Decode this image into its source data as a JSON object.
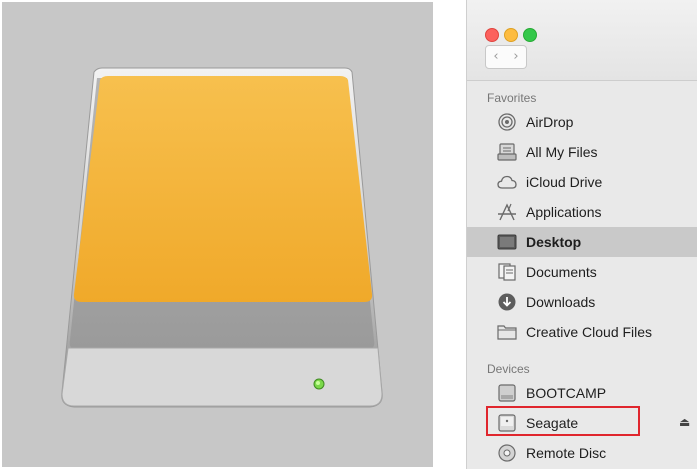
{
  "finder": {
    "sections": {
      "favorites": "Favorites",
      "devices": "Devices"
    },
    "favorites": [
      {
        "label": "AirDrop",
        "icon": "airdrop-icon"
      },
      {
        "label": "All My Files",
        "icon": "all-my-files-icon"
      },
      {
        "label": "iCloud Drive",
        "icon": "icloud-drive-icon"
      },
      {
        "label": "Applications",
        "icon": "applications-icon"
      },
      {
        "label": "Desktop",
        "icon": "desktop-icon",
        "selected": true
      },
      {
        "label": "Documents",
        "icon": "documents-icon"
      },
      {
        "label": "Downloads",
        "icon": "downloads-icon"
      },
      {
        "label": "Creative Cloud Files",
        "icon": "folder-icon"
      }
    ],
    "devices": [
      {
        "label": "BOOTCAMP",
        "icon": "disk-icon"
      },
      {
        "label": "Seagate",
        "icon": "external-disk-icon",
        "eject": "⏏",
        "highlighted": true
      },
      {
        "label": "Remote Disc",
        "icon": "optical-disc-icon"
      }
    ],
    "nav": {
      "back": "‹",
      "forward": "›"
    }
  },
  "colors": {
    "drive_top": "#f4b33c",
    "highlight": "#e0262d",
    "selected_row": "#c9c9c9"
  }
}
